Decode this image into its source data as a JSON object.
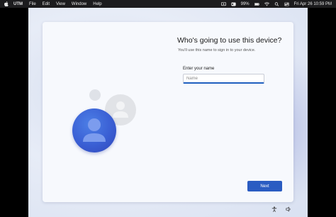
{
  "menubar": {
    "app_name": "UTM",
    "items": [
      "File",
      "Edit",
      "View",
      "Window",
      "Help"
    ],
    "battery": "99%",
    "datetime": "Fri Apr 26  10:59 PM"
  },
  "setup": {
    "title": "Who's going to use this device?",
    "subtitle": "You'll use this name to sign in to your device.",
    "name_label": "Enter your name",
    "name_placeholder": "Name",
    "name_value": "",
    "next_label": "Next"
  },
  "icons": {
    "apple": "apple-logo-icon",
    "screen_mirror": "screen-mirror-icon",
    "control_center": "control-center-icon",
    "battery": "battery-icon",
    "wifi": "wifi-icon",
    "search": "search-icon",
    "toggle": "toggle-icon",
    "accessibility": "accessibility-icon",
    "volume": "volume-icon"
  },
  "colors": {
    "accent": "#2a5cc2",
    "avatar_blue": "#3a5fd4"
  }
}
